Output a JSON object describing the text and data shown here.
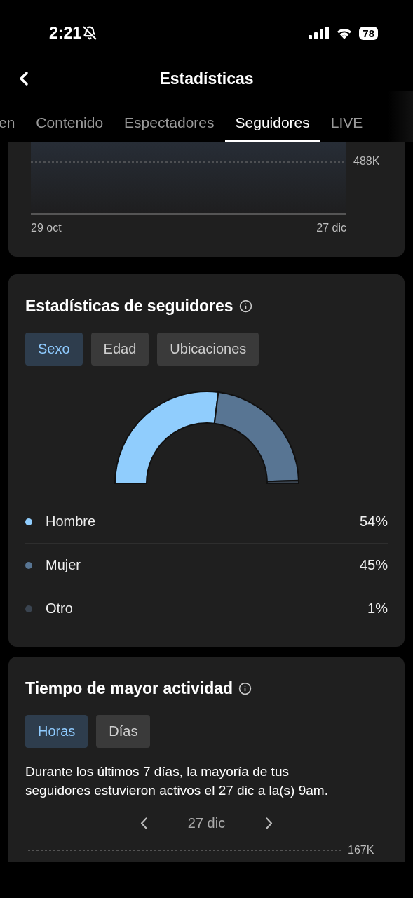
{
  "status_bar": {
    "time": "2:21",
    "battery": "78"
  },
  "header": {
    "title": "Estadísticas"
  },
  "tabs": [
    {
      "label": "en",
      "selected": false
    },
    {
      "label": "Contenido",
      "selected": false
    },
    {
      "label": "Espectadores",
      "selected": false
    },
    {
      "label": "Seguidores",
      "selected": true
    },
    {
      "label": "LIVE",
      "selected": false
    }
  ],
  "followers_chart": {
    "y_label": "488K",
    "x_start": "29 oct",
    "x_end": "27 dic"
  },
  "follower_stats": {
    "title": "Estadísticas de seguidores",
    "filters": [
      {
        "label": "Sexo",
        "selected": true
      },
      {
        "label": "Edad",
        "selected": false
      },
      {
        "label": "Ubicaciones",
        "selected": false
      }
    ],
    "chart_data": {
      "type": "donut",
      "categories": [
        "Hombre",
        "Mujer",
        "Otro"
      ],
      "values": [
        54,
        45,
        1
      ]
    },
    "legend": [
      {
        "value": "54%",
        "color": "#90cdfd"
      },
      {
        "value": "45%",
        "color": "#587593"
      },
      {
        "value": "1%",
        "color": "#3a4450"
      }
    ]
  },
  "activity": {
    "title": "Tiempo de mayor actividad",
    "filters": [
      {
        "label": "Horas",
        "selected": true
      },
      {
        "label": "Días",
        "selected": false
      }
    ],
    "summary": "Durante los últimos 7 días, la mayoría de tus seguidores estuvieron activos el 27 dic a la(s) 9am.",
    "date": "27 dic",
    "y_label": "167K"
  }
}
